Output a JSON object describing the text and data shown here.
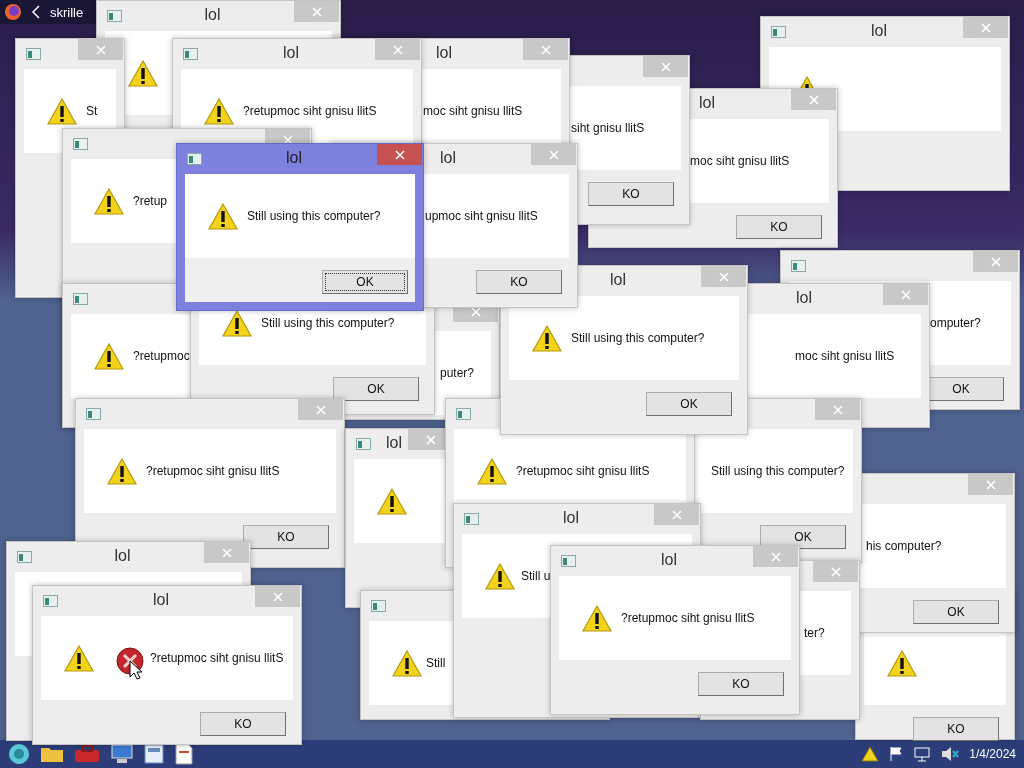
{
  "browser": {
    "tab_title": "skrille"
  },
  "windows": [
    {
      "title": "lol",
      "active": false
    },
    {
      "title": "lol",
      "active": false
    },
    {
      "message": "St",
      "active": false
    },
    {
      "title": "lol",
      "message": "?retupmoc siht gnisu llitS",
      "active": false
    },
    {
      "title": "lol",
      "message": "moc siht gnisu llitS",
      "active": false
    },
    {
      "message": "siht gnisu llitS",
      "button": "KO",
      "active": false
    },
    {
      "title": "lol",
      "message": "moc siht gnisu llitS",
      "button": "KO",
      "active": false
    },
    {
      "message": "?retup",
      "active": false
    },
    {
      "title": "lol",
      "message": "Still using this computer?",
      "button": "OK",
      "active": true
    },
    {
      "title": "lol",
      "message": "upmoc siht gnisu llitS",
      "button": "KO",
      "active": false
    },
    {
      "message": "Still using this computer?",
      "button": "OK",
      "active": false
    },
    {
      "message": "omputer?",
      "button": "OK",
      "active": false
    },
    {
      "title": "lol",
      "message": "Still using this computer?",
      "button": "OK",
      "active": false
    },
    {
      "message": "?retupmoc",
      "active": false
    },
    {
      "title": "lol",
      "message": "moc siht gnisu llitS",
      "active": false
    },
    {
      "message": "puter?",
      "active": false
    },
    {
      "message": "?retupmoc siht gnisu llitS",
      "button": "KO",
      "active": false
    },
    {
      "message": "?retupmoc siht gnisu llitS",
      "active": false
    },
    {
      "message": "Still using this computer?",
      "button": "OK",
      "active": false
    },
    {
      "title": "lol",
      "active": false
    },
    {
      "message": "his computer?",
      "button": "OK",
      "active": false
    },
    {
      "title": "lol",
      "message": "Still u",
      "active": false
    },
    {
      "title": "lol",
      "active": false
    },
    {
      "title": "lol",
      "message": "?retupmoc siht gnisu llitS",
      "button": "KO",
      "active": false
    },
    {
      "message": "ter?",
      "active": false
    },
    {
      "title": "lol",
      "message": "?retupmoc siht gnisu llitS",
      "button": "KO",
      "active": false
    },
    {
      "message": "Still",
      "active": false
    },
    {
      "button": "KO",
      "active": false
    }
  ],
  "taskbar": {
    "date": "1/4/2024"
  }
}
